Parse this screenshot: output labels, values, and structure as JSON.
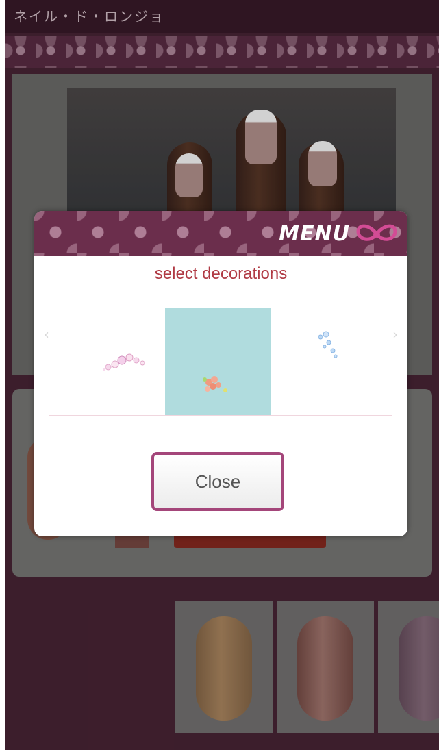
{
  "app": {
    "title": "ネイル・ド・ロンジョ"
  },
  "dialog": {
    "header_label": "MENU",
    "subtitle": "select decorations",
    "nav_prev": "‹",
    "nav_next": "›",
    "decorations": [
      {
        "name": "pink-pearl-decoration",
        "selected": false
      },
      {
        "name": "flower-gem-decoration",
        "selected": true
      },
      {
        "name": "blue-gem-decoration",
        "selected": false
      }
    ],
    "close_label": "Close"
  },
  "colors": {
    "background": "#4a2536",
    "accent": "#a4467a",
    "subtitle": "#b03a44",
    "selected_bg": "#b0dcde"
  }
}
